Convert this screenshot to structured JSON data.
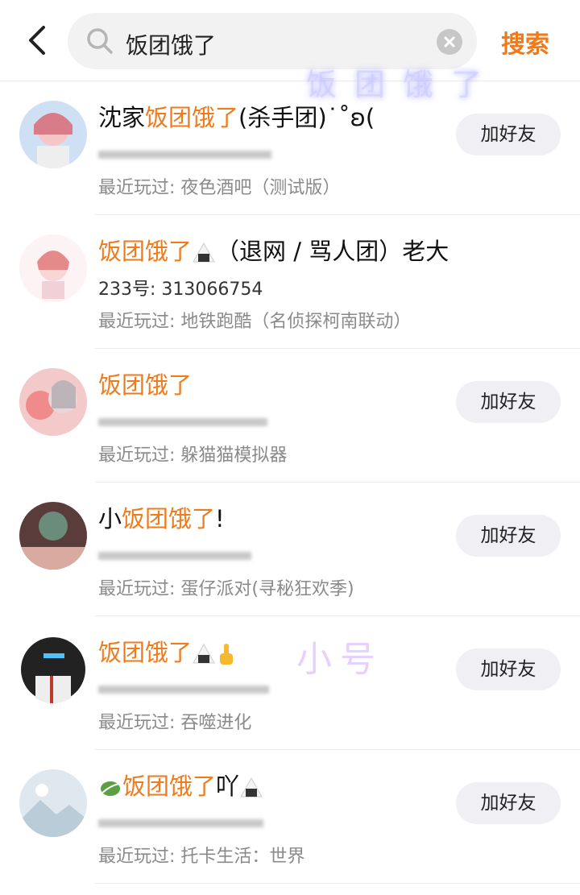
{
  "search": {
    "query": "饭团饿了",
    "button_label": "搜索"
  },
  "watermarks": {
    "top": "饭团饿了",
    "middle": "小号"
  },
  "results": [
    {
      "name_prefix": "沈家",
      "name_highlight": "饭团饿了",
      "name_suffix": "(杀手团)˙˚ʚ(",
      "id_text": "",
      "played_label": "最近玩过: 夜色酒吧（测试版）",
      "button": "加好友"
    },
    {
      "name_prefix": "",
      "name_highlight": "饭团饿了",
      "name_suffix": "（退网 / 骂人团）老大",
      "id_text": "233号: 313066754",
      "played_label": "最近玩过: 地铁跑酷（名侦探柯南联动）",
      "button": ""
    },
    {
      "name_prefix": "",
      "name_highlight": "饭团饿了",
      "name_suffix": "",
      "id_text": "",
      "played_label": "最近玩过: 躲猫猫模拟器",
      "button": "加好友"
    },
    {
      "name_prefix": "小",
      "name_highlight": "饭团饿了",
      "name_suffix": "!",
      "id_text": "",
      "played_label": "最近玩过: 蛋仔派对(寻秘狂欢季)",
      "button": "加好友"
    },
    {
      "name_prefix": "",
      "name_highlight": "饭团饿了",
      "name_suffix": "",
      "id_text": "",
      "played_label": "最近玩过: 吞噬进化",
      "button": "加好友"
    },
    {
      "name_prefix": "",
      "name_highlight": "饭团饿了",
      "name_suffix": "吖",
      "id_text": "",
      "played_label": "最近玩过: 托卡生活：世界",
      "button": "加好友"
    }
  ],
  "colors": {
    "accent": "#ef7b1c",
    "button_bg": "#efeff4"
  }
}
